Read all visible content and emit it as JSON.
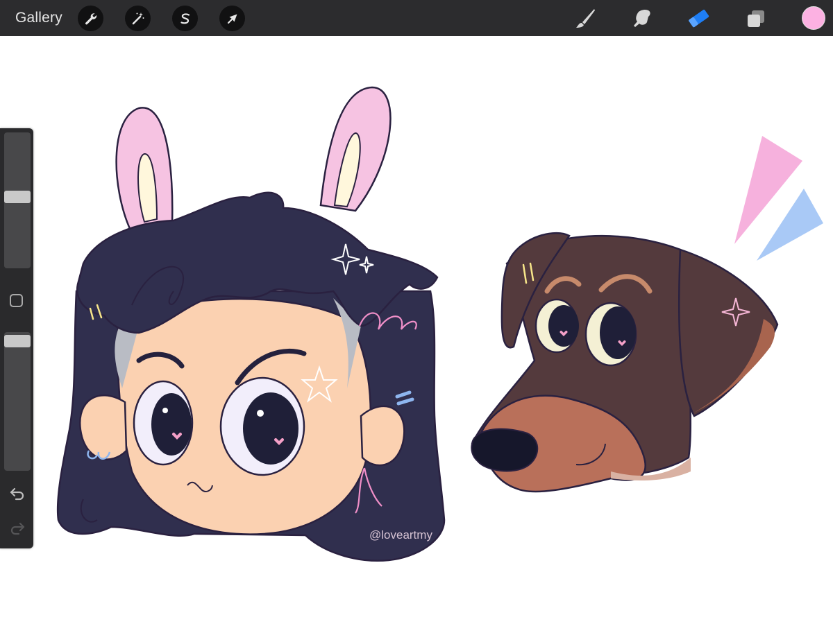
{
  "toolbar": {
    "gallery_label": "Gallery",
    "left_tools": [
      "wrench-icon",
      "magic-wand-icon",
      "selection-icon",
      "transform-arrow-icon"
    ],
    "right_tools": [
      "brush-icon",
      "smudge-icon",
      "eraser-icon",
      "layers-icon"
    ],
    "active_tool": "eraser",
    "active_tool_color": "#1e7ef5",
    "current_color": "#fcb1e2"
  },
  "sidebar": {
    "brush_size_level": 0.53,
    "opacity_level": 0.98
  },
  "canvas": {
    "watermark": "@loveartmy",
    "subjects": [
      "girl-with-bunny-ears",
      "doberman-dog",
      "pink-blue-accent-marks"
    ]
  }
}
